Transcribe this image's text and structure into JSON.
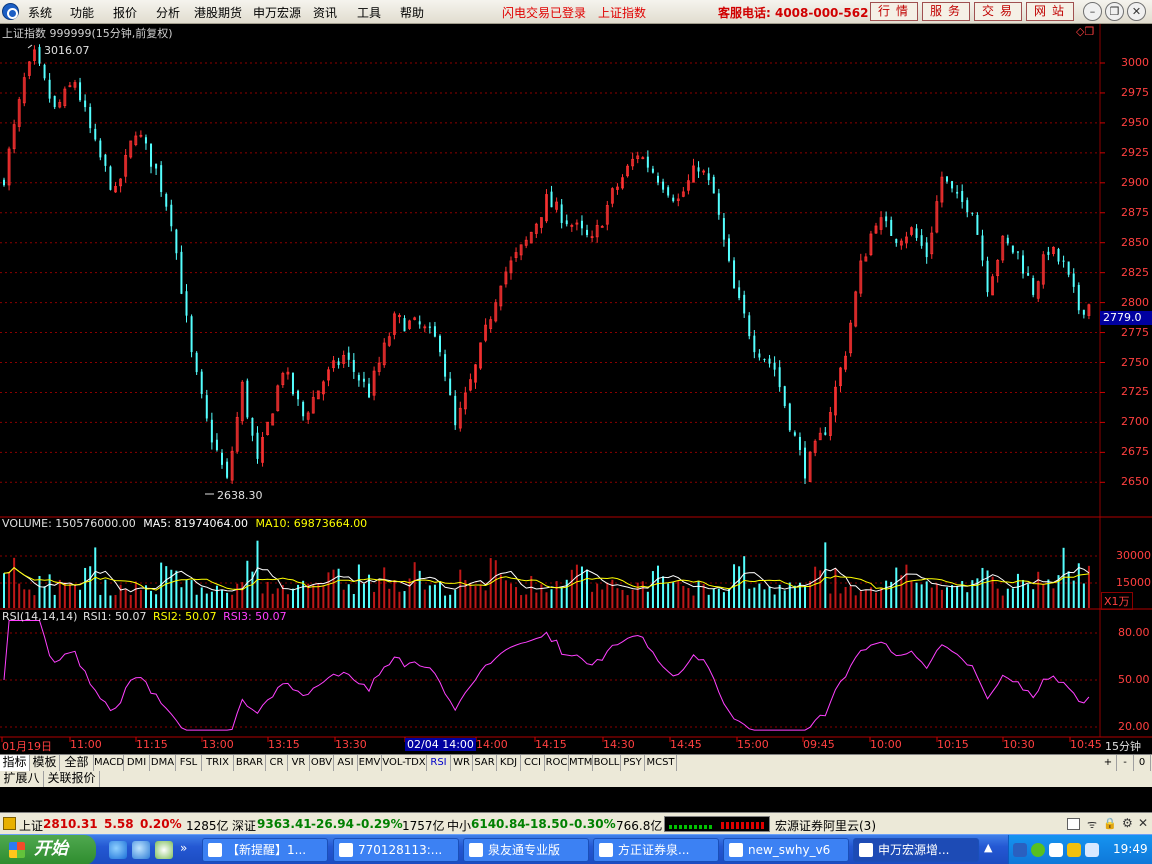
{
  "menu": {
    "items": [
      "系统",
      "功能",
      "报价",
      "分析",
      "港股期货",
      "申万宏源",
      "资讯",
      "工具",
      "帮助"
    ],
    "flash_login": "闪电交易已登录",
    "index_name": "上证指数",
    "hotline": "客服电话: 4008-000-562",
    "right_buttons": [
      "行情",
      "服务",
      "交易",
      "网站"
    ]
  },
  "chart": {
    "title": "上证指数 999999(15分钟,前复权)",
    "max_label": "3016.07",
    "min_label": "2638.30",
    "current_price": "2779.0",
    "price_ticks": [
      "3000",
      "2975",
      "2950",
      "2925",
      "2900",
      "2875",
      "2850",
      "2825",
      "2800",
      "2775",
      "2750",
      "2725",
      "2700",
      "2675",
      "2650"
    ],
    "volume": {
      "label": "VOLUME:",
      "value": "150576000.00",
      "ma5_label": "MA5:",
      "ma5": "81974064.00",
      "ma10_label": "MA10:",
      "ma10": "69873664.00",
      "ticks": [
        "30000",
        "15000"
      ],
      "unit": "X1万"
    },
    "rsi": {
      "label": "RSI(14,14,14)",
      "rsi1_label": "RSI1:",
      "rsi1": "50.07",
      "rsi2_label": "RSI2:",
      "rsi2": "50.07",
      "rsi3_label": "RSI3:",
      "rsi3": "50.07",
      "ticks": [
        "80.00",
        "50.00",
        "20.00"
      ]
    },
    "time_axis": [
      "01月19日",
      "11:00",
      "11:15",
      "13:00",
      "13:15",
      "13:30",
      "02/04 14:00",
      "14:00",
      "14:15",
      "14:30",
      "14:45",
      "15:00",
      "09:45",
      "10:00",
      "10:15",
      "10:30",
      "10:45"
    ],
    "period": "15分钟",
    "colors": {
      "up": "#ff3232",
      "down": "#54ffff",
      "ma5": "#ffffff",
      "ma10": "#ffff00",
      "rsi": "#ff40ff",
      "grid": "#8b0000",
      "price_highlight": "#0000a0"
    }
  },
  "indicator_tabs": [
    "指标",
    "模板",
    "全部",
    "MACD",
    "DMI",
    "DMA",
    "FSL",
    "TRIX",
    "BRAR",
    "CR",
    "VR",
    "OBV",
    "ASI",
    "EMV",
    "VOL-TDX",
    "RSI",
    "WR",
    "SAR",
    "KDJ",
    "CCI",
    "ROC",
    "MTM",
    "BOLL",
    "PSY",
    "MCST"
  ],
  "tab_controls": [
    "+",
    "-",
    "0"
  ],
  "second_row": [
    "扩展八",
    "关联报价"
  ],
  "status": {
    "sh_label": "上证",
    "sh_value": "2810.31",
    "sh_change": "5.58",
    "sh_pct": "0.20%",
    "sh_amount": "1285亿",
    "sz_label": "深证",
    "sz_value": "9363.41",
    "sz_change": "-26.94",
    "sz_pct": "-0.29%",
    "sz_amount": "1757亿",
    "sme_label": "中小",
    "sme_value": "6140.84",
    "sme_change": "-18.50",
    "sme_pct": "-0.30%",
    "sme_amount": "766.8亿",
    "broker": "宏源证券阿里云(3)"
  },
  "taskbar": {
    "start": "开始",
    "items": [
      "【新提醒】1...",
      "770128113:...",
      "泉友通专业版",
      "方正证券泉...",
      "new_swhy_v6",
      "申万宏源增..."
    ],
    "time": "19:49"
  }
}
